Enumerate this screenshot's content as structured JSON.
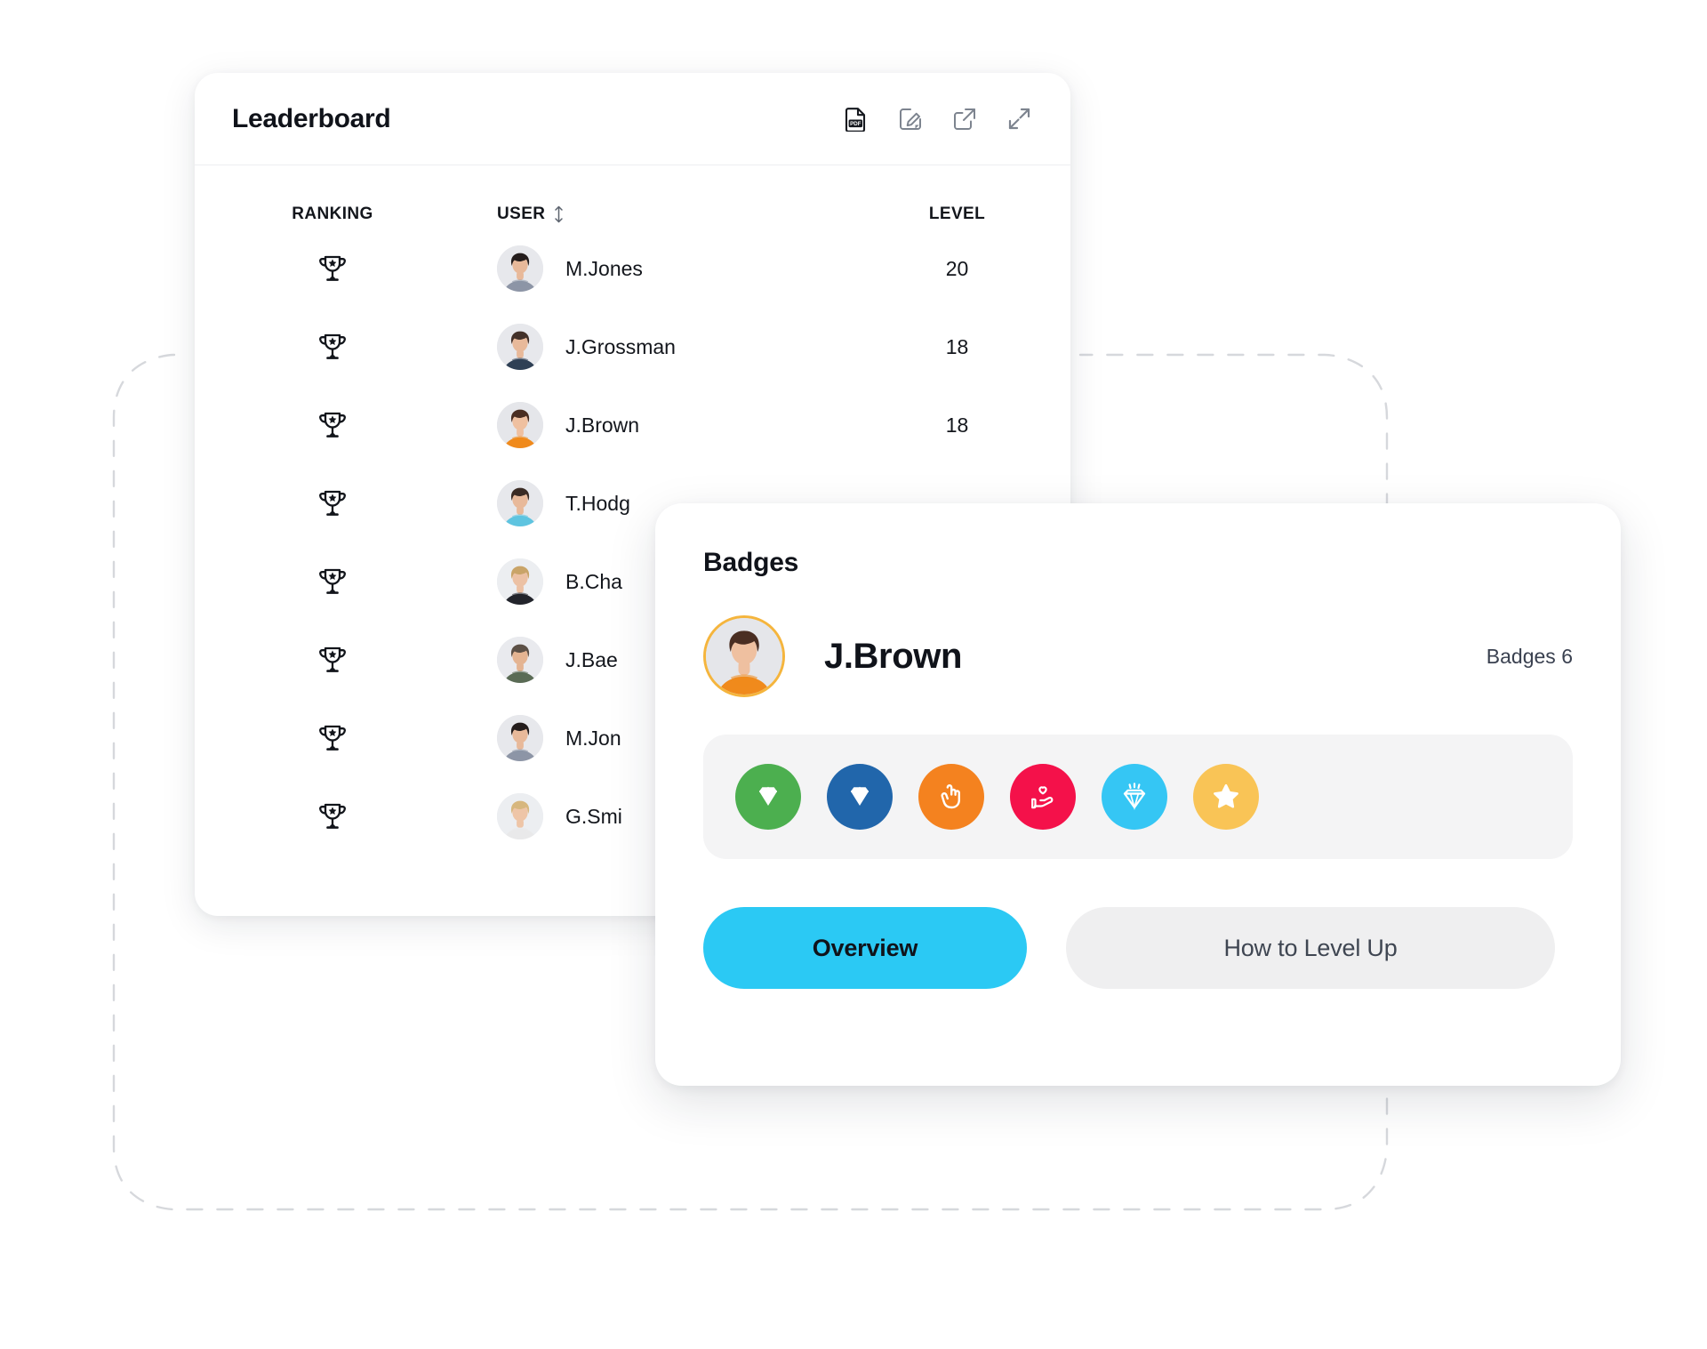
{
  "leaderboard": {
    "title": "Leaderboard",
    "actions": [
      {
        "name": "export-pdf-icon",
        "label": "PDF"
      },
      {
        "name": "edit-icon",
        "label": "Edit"
      },
      {
        "name": "open-external-icon",
        "label": "Open"
      },
      {
        "name": "expand-icon",
        "label": "Expand"
      }
    ],
    "columns": {
      "ranking": "RANKING",
      "user": "USER",
      "level": "LEVEL",
      "sort_icon": "sort-vertical-icon"
    },
    "rank_icon": "trophy-star-icon",
    "rows": [
      {
        "user": "M.Jones",
        "level": "20",
        "avatar": "woman-dark-hair-grey-top"
      },
      {
        "user": "J.Grossman",
        "level": "18",
        "avatar": "man-navy-blazer"
      },
      {
        "user": "J.Brown",
        "level": "18",
        "avatar": "woman-orange-top"
      },
      {
        "user": "T.Hodg",
        "level": "",
        "avatar": "man-light-blue-shirt"
      },
      {
        "user": "B.Cha",
        "level": "",
        "avatar": "woman-glasses-black-top"
      },
      {
        "user": "J.Bae",
        "level": "",
        "avatar": "man-green-tshirt"
      },
      {
        "user": "M.Jon",
        "level": "",
        "avatar": "woman-dark-hair-grey-top"
      },
      {
        "user": "G.Smi",
        "level": "",
        "avatar": "woman-blonde-white-top"
      }
    ]
  },
  "badges": {
    "title": "Badges",
    "profile": {
      "name": "J.Brown",
      "avatar": "woman-orange-top",
      "ring_color": "#f5b53d"
    },
    "count_label": "Badges 6",
    "items": [
      {
        "name": "badge-diamond-green",
        "icon": "diamond-icon",
        "color": "#4caf4f"
      },
      {
        "name": "badge-diamond-blue",
        "icon": "diamond-icon",
        "color": "#2166ab"
      },
      {
        "name": "badge-rock-hand",
        "icon": "rock-hand-icon",
        "color": "#f4821f"
      },
      {
        "name": "badge-heart-hand",
        "icon": "heart-in-hand-icon",
        "color": "#f4114a"
      },
      {
        "name": "badge-gem-sparkle",
        "icon": "sparkling-gem-icon",
        "color": "#35c6f4"
      },
      {
        "name": "badge-star",
        "icon": "star-icon",
        "color": "#f9c456"
      }
    ],
    "buttons": {
      "overview": "Overview",
      "level_up": "How to Level Up"
    },
    "colors": {
      "primary": "#2bc9f4",
      "secondary": "#efeff0",
      "strip_bg": "#f4f4f5"
    }
  },
  "background": {
    "dashed_path_color": "#d6d8dc"
  }
}
